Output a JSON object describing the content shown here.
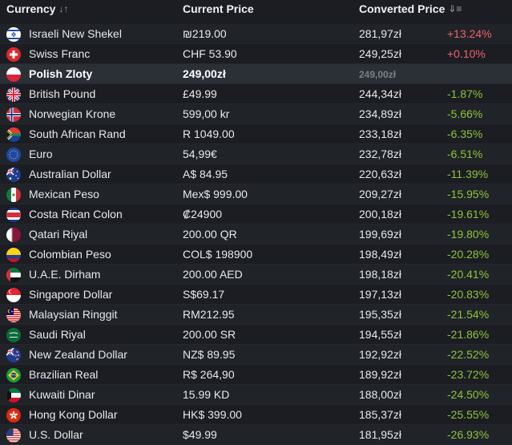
{
  "header": {
    "currency_label": "Currency",
    "currency_sort_icon": "↓↑",
    "current_price_label": "Current Price",
    "converted_price_label": "Converted Price",
    "converted_sort_icon": "⇓≡"
  },
  "colors": {
    "positive": "#f0626a",
    "negative": "#8fc43c",
    "highlight_row": "#2b2f36"
  },
  "rows": [
    {
      "flag": "israel-flag",
      "currency": "Israeli New Shekel",
      "price": "₪219.00",
      "converted": "281,97zł",
      "change": "+13.24%",
      "dir": "pos"
    },
    {
      "flag": "switzerland-flag",
      "currency": "Swiss Franc",
      "price": "CHF 53.90",
      "converted": "249,25zł",
      "change": "+0.10%",
      "dir": "pos"
    },
    {
      "flag": "poland-flag",
      "currency": "Polish Zloty",
      "price": "249,00zł",
      "converted": "249,00zł",
      "change": "",
      "dir": "base"
    },
    {
      "flag": "uk-flag",
      "currency": "British Pound",
      "price": "£49.99",
      "converted": "244,34zł",
      "change": "-1.87%",
      "dir": "neg"
    },
    {
      "flag": "norway-flag",
      "currency": "Norwegian Krone",
      "price": "599,00 kr",
      "converted": "234,89zł",
      "change": "-5.66%",
      "dir": "neg"
    },
    {
      "flag": "south-africa-flag",
      "currency": "South African Rand",
      "price": "R 1049.00",
      "converted": "233,18zł",
      "change": "-6.35%",
      "dir": "neg"
    },
    {
      "flag": "eu-flag",
      "currency": "Euro",
      "price": "54,99€",
      "converted": "232,78zł",
      "change": "-6.51%",
      "dir": "neg"
    },
    {
      "flag": "australia-flag",
      "currency": "Australian Dollar",
      "price": "A$ 84.95",
      "converted": "220,63zł",
      "change": "-11.39%",
      "dir": "neg"
    },
    {
      "flag": "mexico-flag",
      "currency": "Mexican Peso",
      "price": "Mex$ 999.00",
      "converted": "209,27zł",
      "change": "-15.95%",
      "dir": "neg"
    },
    {
      "flag": "costa-rica-flag",
      "currency": "Costa Rican Colon",
      "price": "₡24900",
      "converted": "200,18zł",
      "change": "-19.61%",
      "dir": "neg"
    },
    {
      "flag": "qatar-flag",
      "currency": "Qatari Riyal",
      "price": "200.00 QR",
      "converted": "199,69zł",
      "change": "-19.80%",
      "dir": "neg"
    },
    {
      "flag": "colombia-flag",
      "currency": "Colombian Peso",
      "price": "COL$ 198900",
      "converted": "198,49zł",
      "change": "-20.28%",
      "dir": "neg"
    },
    {
      "flag": "uae-flag",
      "currency": "U.A.E. Dirham",
      "price": "200.00 AED",
      "converted": "198,18zł",
      "change": "-20.41%",
      "dir": "neg"
    },
    {
      "flag": "singapore-flag",
      "currency": "Singapore Dollar",
      "price": "S$69.17",
      "converted": "197,13zł",
      "change": "-20.83%",
      "dir": "neg"
    },
    {
      "flag": "malaysia-flag",
      "currency": "Malaysian Ringgit",
      "price": "RM212.95",
      "converted": "195,35zł",
      "change": "-21.54%",
      "dir": "neg"
    },
    {
      "flag": "saudi-flag",
      "currency": "Saudi Riyal",
      "price": "200.00 SR",
      "converted": "194,55zł",
      "change": "-21.86%",
      "dir": "neg"
    },
    {
      "flag": "new-zealand-flag",
      "currency": "New Zealand Dollar",
      "price": "NZ$ 89.95",
      "converted": "192,92zł",
      "change": "-22.52%",
      "dir": "neg"
    },
    {
      "flag": "brazil-flag",
      "currency": "Brazilian Real",
      "price": "R$ 264,90",
      "converted": "189,92zł",
      "change": "-23.72%",
      "dir": "neg"
    },
    {
      "flag": "kuwait-flag",
      "currency": "Kuwaiti Dinar",
      "price": "15.99 KD",
      "converted": "188,00zł",
      "change": "-24.50%",
      "dir": "neg"
    },
    {
      "flag": "hong-kong-flag",
      "currency": "Hong Kong Dollar",
      "price": "HK$ 399.00",
      "converted": "185,37zł",
      "change": "-25.55%",
      "dir": "neg"
    },
    {
      "flag": "us-flag",
      "currency": "U.S. Dollar",
      "price": "$49.99",
      "converted": "181,95zł",
      "change": "-26.93%",
      "dir": "neg"
    }
  ]
}
